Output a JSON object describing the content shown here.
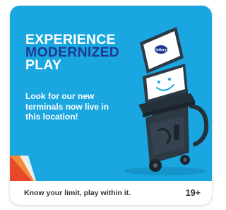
{
  "promo": {
    "headline": [
      "EXPERIENCE",
      "MODERNIZED",
      "PLAY"
    ],
    "body": "Look for our new terminals now live in this location!",
    "terminal_logo": "lottery",
    "footer_message": "Know your limit, play within it.",
    "age_rating": "19+"
  },
  "colors": {
    "background": "#1aa6e0",
    "headline_accent": "#1f3a93",
    "terminal_body": "#2d3a46",
    "corner_accent": "#e8472a"
  },
  "icons": [
    "lottery-terminal-illustration",
    "smiley-screen-icon",
    "corner-accent"
  ]
}
